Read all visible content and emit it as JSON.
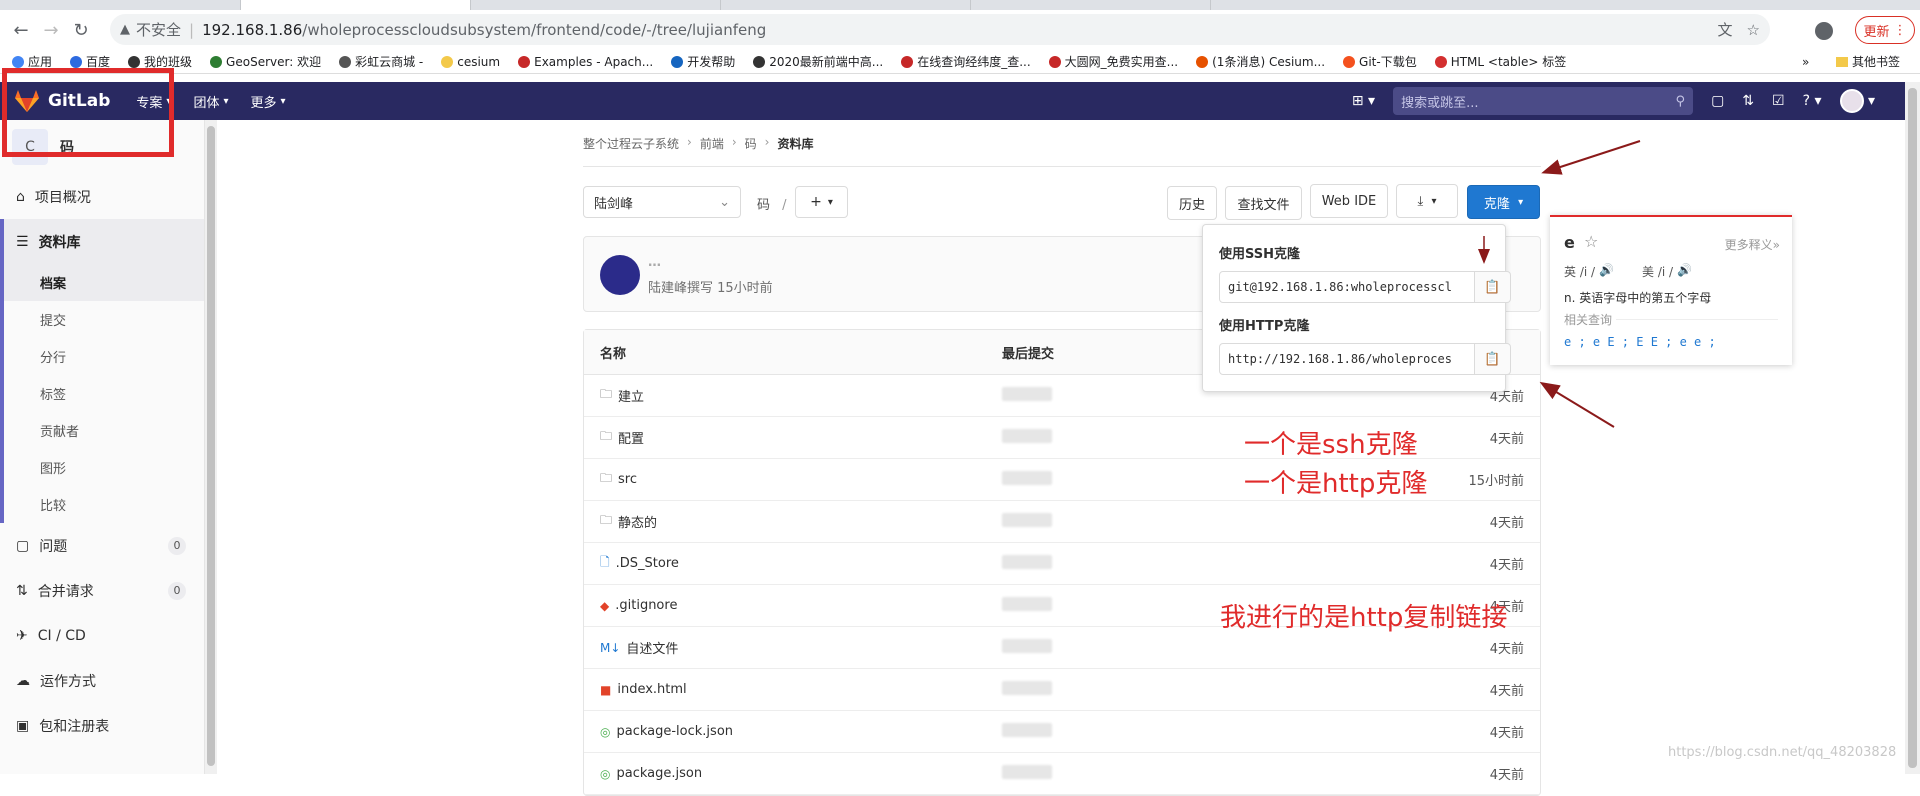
{
  "browser": {
    "insecure_label": "不安全",
    "url_host": "192.168.1.86",
    "url_path": "/wholeprocesscloudsubsystem/frontend/code/-/tree/lujianfeng",
    "update_label": "更新",
    "bookmarks": [
      "应用",
      "百度",
      "我的班级",
      "GeoServer: 欢迎",
      "彩虹云商城 -",
      "cesium",
      "Examples - Apach...",
      "开发帮助",
      "2020最新前端中高...",
      "在线查询经纬度_查...",
      "大圆网_免费实用查...",
      "(1条消息) Cesium...",
      "Git-下载包",
      "HTML <table> 标签"
    ],
    "bookmarks_overflow": "»",
    "other_bookmarks": "其他书签"
  },
  "gitlab_nav": {
    "logo_text": "GitLab",
    "menus": [
      "专案",
      "团体",
      "更多"
    ],
    "search_placeholder": "搜索或跳至..."
  },
  "sidebar": {
    "project_initial": "C",
    "project_name": "码",
    "items": [
      {
        "label": "项目概况",
        "icon": "home-icon"
      },
      {
        "label": "资料库",
        "icon": "document-icon",
        "active": true
      },
      {
        "label": "问题",
        "icon": "issues-icon",
        "badge": "0"
      },
      {
        "label": "合并请求",
        "icon": "merge-request-icon",
        "badge": "0"
      },
      {
        "label": "CI / CD",
        "icon": "rocket-icon"
      },
      {
        "label": "运作方式",
        "icon": "cloud-icon"
      },
      {
        "label": "包和注册表",
        "icon": "package-icon"
      }
    ],
    "repo_sub": [
      "档案",
      "提交",
      "分行",
      "标签",
      "贡献者",
      "图形",
      "比较"
    ]
  },
  "breadcrumb": [
    "整个过程云子系统",
    "前端",
    "码",
    "资料库"
  ],
  "toolbar": {
    "branch": "陆剑峰",
    "path": "码",
    "path_sep": "/",
    "history": "历史",
    "find_file": "查找文件",
    "web_ide": "Web IDE",
    "clone": "克隆"
  },
  "commit": {
    "title": "…",
    "meta": "陆建峰撰写 15小时前"
  },
  "tree": {
    "headers": [
      "名称",
      "最后提交"
    ],
    "rows": [
      {
        "name": "建立",
        "type": "folder",
        "time": "4天前"
      },
      {
        "name": "配置",
        "type": "folder",
        "time": "4天前"
      },
      {
        "name": "src",
        "type": "folder",
        "time": "15小时前"
      },
      {
        "name": "静态的",
        "type": "folder",
        "time": "4天前"
      },
      {
        "name": ".DS_Store",
        "type": "file",
        "time": "4天前"
      },
      {
        "name": ".gitignore",
        "type": "git",
        "time": "4天前"
      },
      {
        "name": "自述文件",
        "type": "markdown",
        "time": "4天前"
      },
      {
        "name": "index.html",
        "type": "html",
        "time": "4天前"
      },
      {
        "name": "package-lock.json",
        "type": "json",
        "time": "4天前"
      },
      {
        "name": "package.json",
        "type": "json",
        "time": "4天前"
      }
    ]
  },
  "clone_dropdown": {
    "ssh_label": "使用SSH克隆",
    "ssh_url": "git@192.168.1.86:wholeprocesscl",
    "http_label": "使用HTTP克隆",
    "http_url": "http://192.168.1.86/wholeproces"
  },
  "dictionary": {
    "word": "e",
    "more": "更多释义»",
    "uk_label": "英 /i /",
    "us_label": "美 /i /",
    "definition": "n. 英语字母中的第五个字母",
    "related_label": "相关查询",
    "related": "e ; e E ; E E ; e e ;"
  },
  "annotations": {
    "ssh_note": "一个是ssh克隆",
    "http_note": "一个是http克隆",
    "action_note": "我进行的是http复制链接"
  },
  "watermark": "https://blog.csdn.net/qq_48203828",
  "colors": {
    "gitlab_nav": "#292961",
    "clone_button": "#1f78d1",
    "annotation": "#e02b2b"
  }
}
